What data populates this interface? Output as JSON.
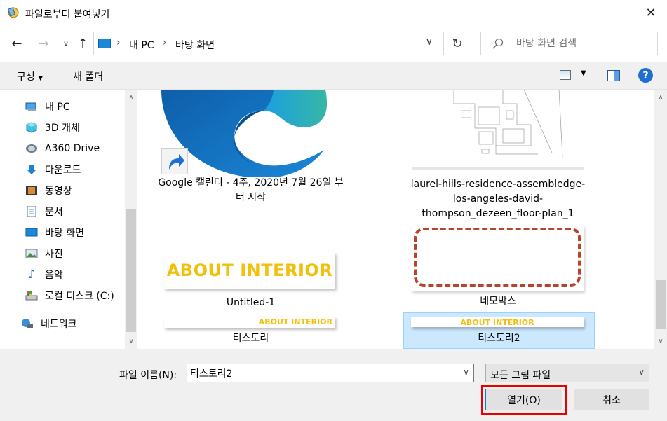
{
  "window": {
    "title": "파일로부터 붙여넣기"
  },
  "address": {
    "crumbs": [
      "내 PC",
      "바탕 화면"
    ],
    "search_placeholder": "바탕 화면 검색"
  },
  "toolbar": {
    "organize": "구성",
    "new_folder": "새 폴더"
  },
  "nav": {
    "items": [
      "내 PC",
      "3D 개체",
      "A360 Drive",
      "다운로드",
      "동영상",
      "문서",
      "바탕 화면",
      "사진",
      "음악",
      "로컬 디스크 (C:)",
      "네트워크"
    ]
  },
  "files": {
    "google_calendar": "Google 캘린더 - 4주, 2020년 7월 26일 부터 시작",
    "floorplan": "laurel-hills-residence-assembledge-los-angeles-david-thompson_dezeen_floor-plan_1",
    "untitled": "Untitled-1",
    "nemo": "네모박스",
    "tistory": "티스토리",
    "tistory2": "티스토리2",
    "about_interior": "ABOUT INTERIOR"
  },
  "footer": {
    "filename_label": "파일 이름(N):",
    "filename_value": "티스토리2",
    "filter": "모든 그림 파일",
    "open": "열기(O)",
    "cancel": "취소"
  },
  "colors": {
    "accent": "#0078d7",
    "selection": "#cce8ff",
    "highlight": "#ee0000",
    "about_text": "#f2c00b"
  }
}
